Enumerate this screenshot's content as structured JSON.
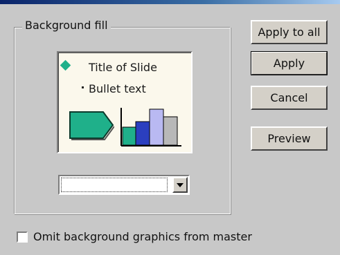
{
  "dialog": {
    "group_title": "Background fill",
    "preview": {
      "title_text": "Title of Slide",
      "bullet_text": "Bullet text"
    },
    "fill_dropdown": {
      "selected_value": ""
    },
    "buttons": {
      "apply_to_all": "Apply to all",
      "apply": "Apply",
      "cancel": "Cancel",
      "preview": "Preview"
    },
    "omit_checkbox": {
      "label": "Omit background graphics from master",
      "checked": false
    }
  },
  "colors": {
    "dialog_bg": "#c8c8c8",
    "preview_bg": "#fbf8ec",
    "accent_green": "#1fb08a",
    "bar_blue": "#2b3fbf",
    "bar_lavender": "#b9b9f2",
    "bar_gray": "#b8b8b8"
  },
  "icons": [
    "diamond-bullet-icon",
    "pentagon-arrow-icon",
    "bar-chart-icon",
    "chevron-down-icon"
  ]
}
